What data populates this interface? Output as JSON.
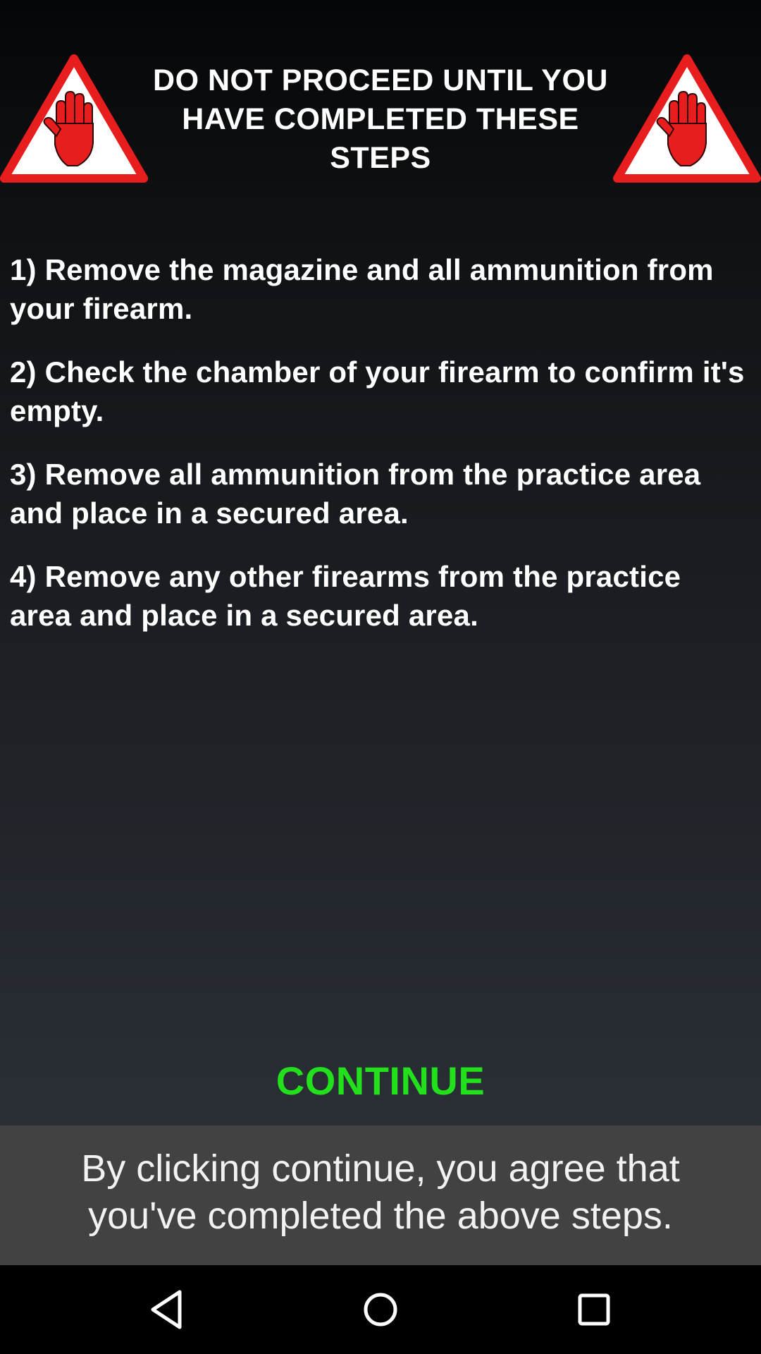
{
  "header": {
    "title": "DO NOT PROCEED UNTIL YOU HAVE COMPLETED THESE STEPS",
    "left_icon": "stop-hand-warning-icon",
    "right_icon": "stop-hand-warning-icon"
  },
  "steps": [
    {
      "text": "1) Remove the magazine and all ammunition from your firearm."
    },
    {
      "text": "2) Check the chamber of your firearm to confirm it's empty."
    },
    {
      "text": "3) Remove all ammunition from the practice area and place in a secured area."
    },
    {
      "text": "4) Remove any other firearms from the practice area and place in a secured area."
    }
  ],
  "continue_button": {
    "label": "CONTINUE"
  },
  "agreement": {
    "text": "By clicking continue, you agree that you've completed the above steps."
  },
  "navbar": {
    "back_icon": "back-triangle-icon",
    "home_icon": "home-circle-icon",
    "recents_icon": "recents-square-icon"
  },
  "colors": {
    "continue": "#22e01b",
    "warning_red": "#e81e1e",
    "agreement_bg": "#424242"
  }
}
